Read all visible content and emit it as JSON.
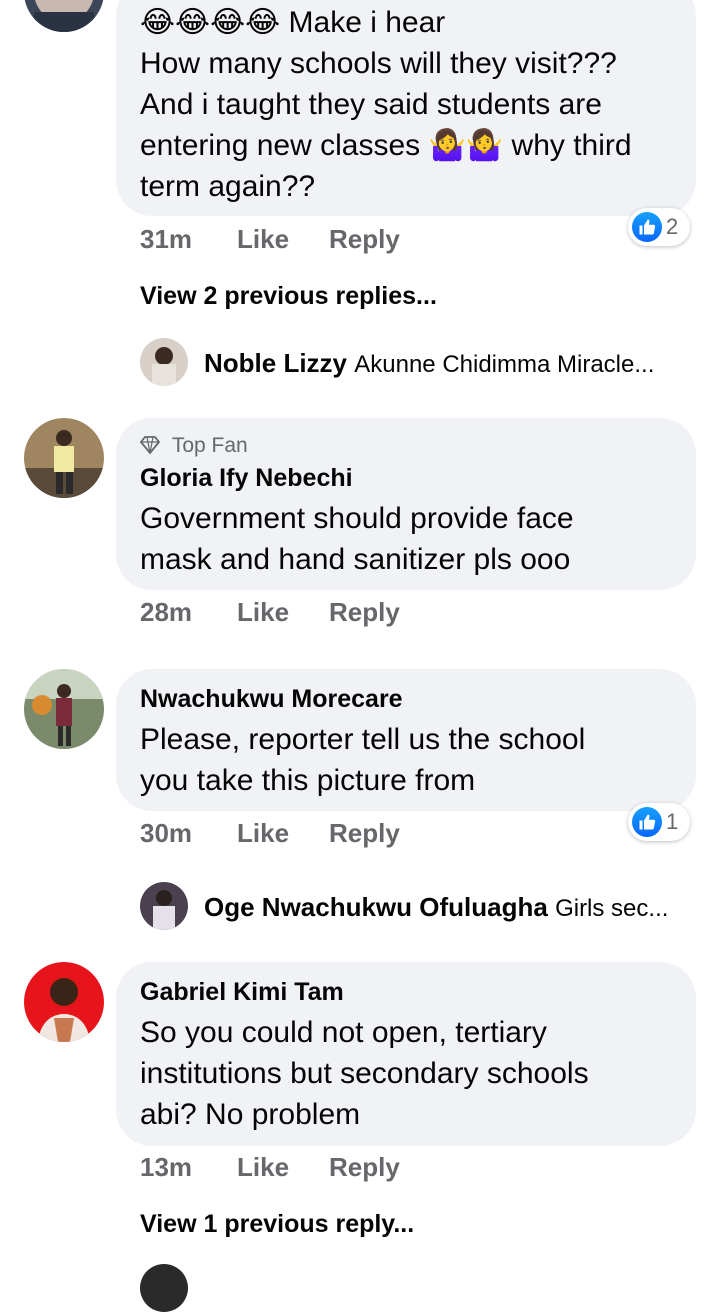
{
  "comments": [
    {
      "id": "c1",
      "lines": [
        "😂😂😂😂 Make i hear",
        "How many schools will they visit???",
        "And i taught they said students are",
        "entering new classes 🤷‍♀️🤷‍♀️ why third",
        "term again??"
      ],
      "time": "31m",
      "like_label": "Like",
      "reply_label": "Reply",
      "reaction_count": "2",
      "view_more": "View 2 previous replies...",
      "reply_preview": {
        "name": "Noble Lizzy",
        "text": "Akunne Chidimma Miracle..."
      }
    },
    {
      "id": "c2",
      "badge": "Top Fan",
      "author": "Gloria Ify Nebechi",
      "lines": [
        "Government should provide face",
        "mask and hand sanitizer pls ooo"
      ],
      "time": "28m",
      "like_label": "Like",
      "reply_label": "Reply"
    },
    {
      "id": "c3",
      "author": "Nwachukwu Morecare",
      "lines": [
        "Please, reporter tell us the school",
        "you take this picture from"
      ],
      "time": "30m",
      "like_label": "Like",
      "reply_label": "Reply",
      "reaction_count": "1",
      "reply_preview": {
        "name": "Oge Nwachukwu Ofuluagha",
        "text": "Girls sec..."
      }
    },
    {
      "id": "c4",
      "author": "Gabriel Kimi Tam",
      "lines": [
        "So you could not open, tertiary",
        "institutions but secondary schools",
        "abi? No problem"
      ],
      "time": "13m",
      "like_label": "Like",
      "reply_label": "Reply",
      "view_more": "View 1 previous reply..."
    }
  ],
  "icons": {
    "reaction": "like-icon",
    "top_fan": "diamond-icon"
  },
  "colors": {
    "bubble": "#f0f2f5",
    "meta": "#65676b",
    "like_blue": "#0866ff"
  }
}
